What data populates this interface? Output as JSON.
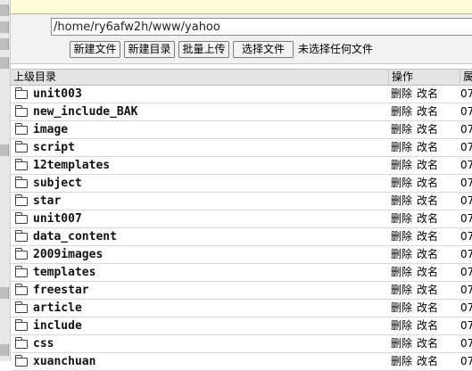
{
  "path_value": "/home/ry6afw2h/www/yahoo",
  "buttons": {
    "new_file": "新建文件",
    "new_dir": "新建目录",
    "batch_upload": "批量上传",
    "choose_file": "选择文件"
  },
  "no_file_text": "未选择任何文件",
  "header": {
    "parent_dir": "上级目录",
    "actions": "操作",
    "col3": "属"
  },
  "row_actions": {
    "delete": "删除",
    "rename": "改名"
  },
  "rows": [
    {
      "name": "unit003",
      "col3": "07"
    },
    {
      "name": "new_include_BAK",
      "col3": "07"
    },
    {
      "name": "image",
      "col3": "07"
    },
    {
      "name": "script",
      "col3": "07"
    },
    {
      "name": "12templates",
      "col3": "07"
    },
    {
      "name": "subject",
      "col3": "07"
    },
    {
      "name": "star",
      "col3": "07"
    },
    {
      "name": "unit007",
      "col3": "07"
    },
    {
      "name": "data_content",
      "col3": "07"
    },
    {
      "name": "2009images",
      "col3": "07"
    },
    {
      "name": "templates",
      "col3": "07"
    },
    {
      "name": "freestar",
      "col3": "07"
    },
    {
      "name": "article",
      "col3": "07"
    },
    {
      "name": "include",
      "col3": "07"
    },
    {
      "name": "css",
      "col3": "07"
    },
    {
      "name": "xuanchuan",
      "col3": "07"
    }
  ]
}
